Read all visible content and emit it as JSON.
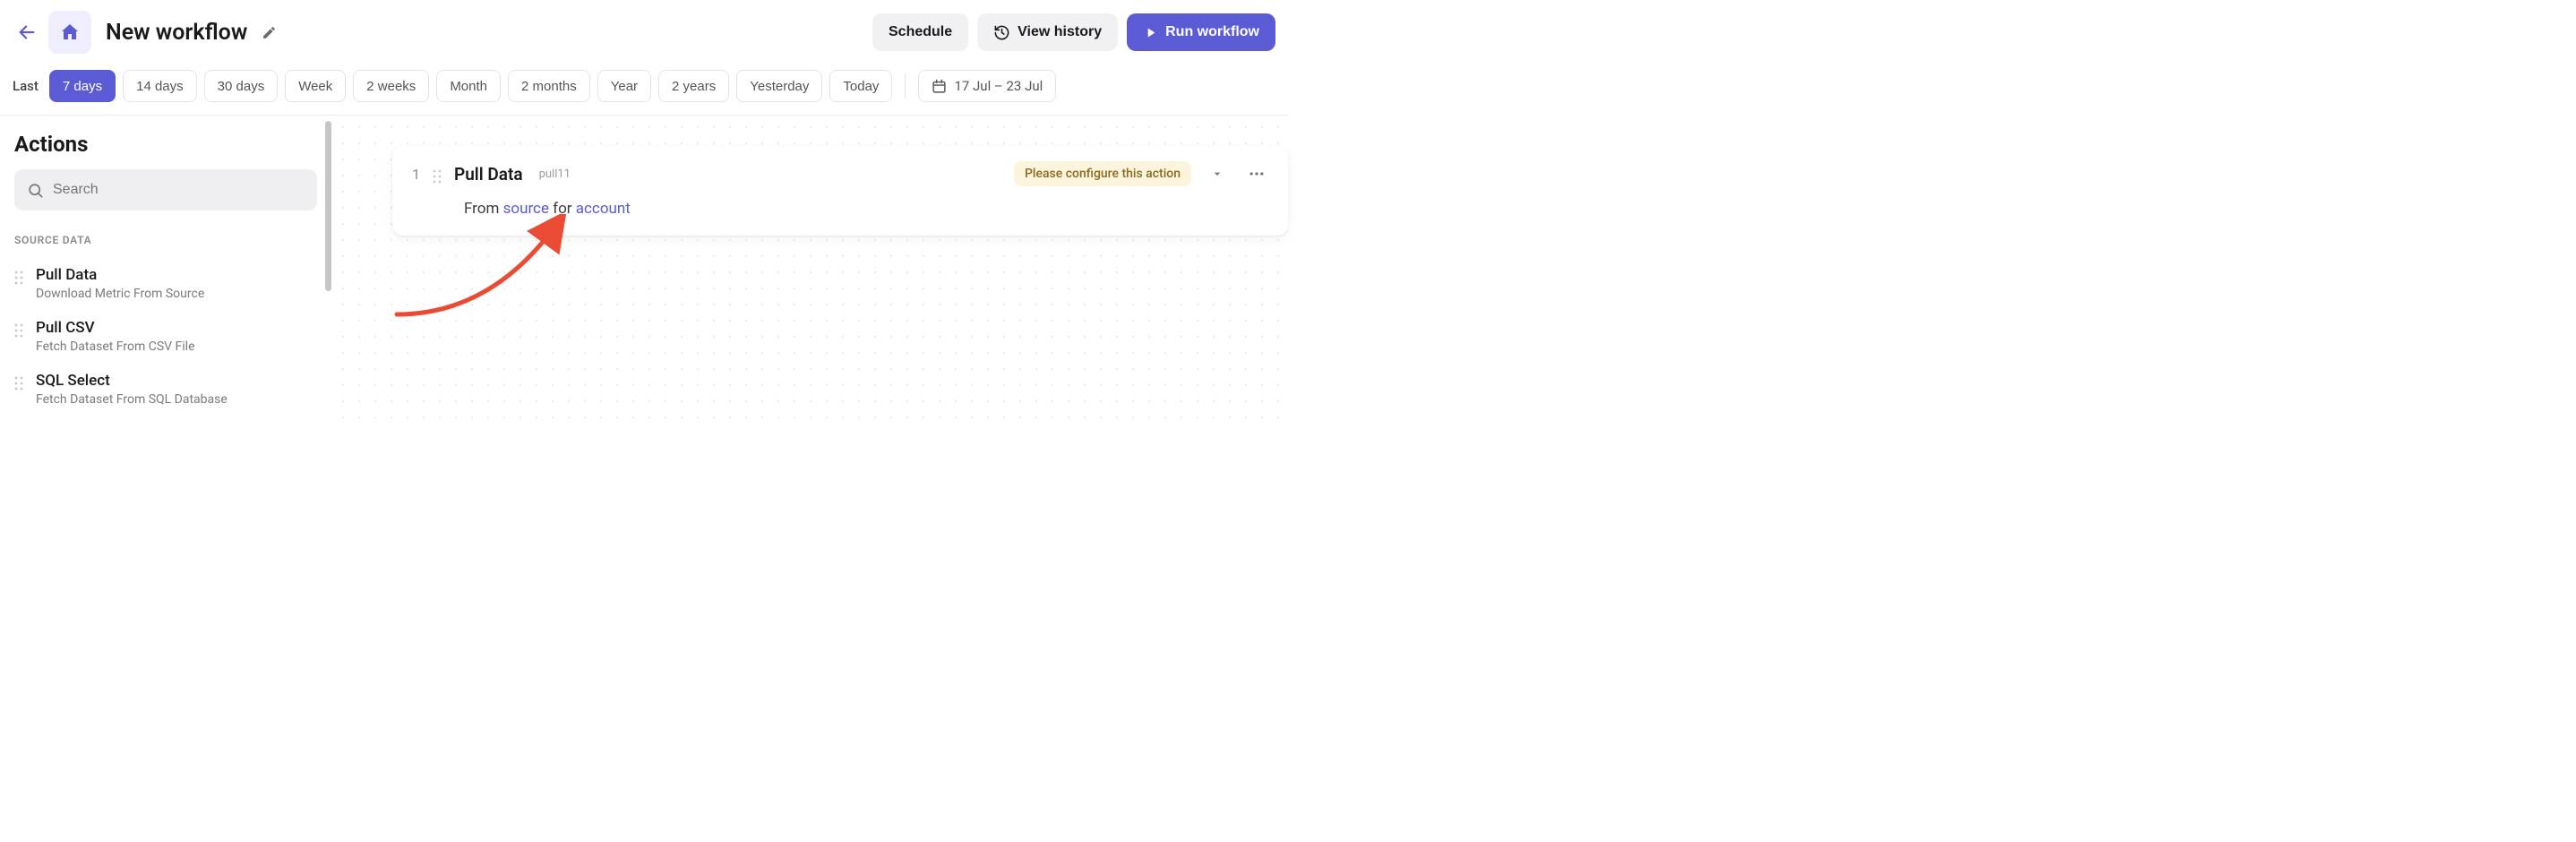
{
  "header": {
    "title": "New workflow",
    "schedule_label": "Schedule",
    "history_label": "View history",
    "run_label": "Run workflow"
  },
  "range": {
    "label": "Last",
    "chips": [
      "7 days",
      "14 days",
      "30 days",
      "Week",
      "2 weeks",
      "Month",
      "2 months",
      "Year",
      "2 years",
      "Yesterday",
      "Today"
    ],
    "active_index": 0,
    "date_display": "17 Jul – 23 Jul"
  },
  "sidebar": {
    "heading": "Actions",
    "search_placeholder": "Search",
    "section": "SOURCE DATA",
    "items": [
      {
        "title": "Pull Data",
        "desc": "Download Metric From Source"
      },
      {
        "title": "Pull CSV",
        "desc": "Fetch Dataset From CSV File"
      },
      {
        "title": "SQL Select",
        "desc": "Fetch Dataset From SQL Database"
      }
    ]
  },
  "step": {
    "number": "1",
    "title": "Pull Data",
    "id": "pull11",
    "warning": "Please configure this action",
    "body_prefix": "From ",
    "body_source": "source",
    "body_mid": " for ",
    "body_account": "account"
  },
  "colors": {
    "primary": "#5B5BD6",
    "warn_bg": "#FDF4DE",
    "warn_fg": "#8a6b1e"
  }
}
